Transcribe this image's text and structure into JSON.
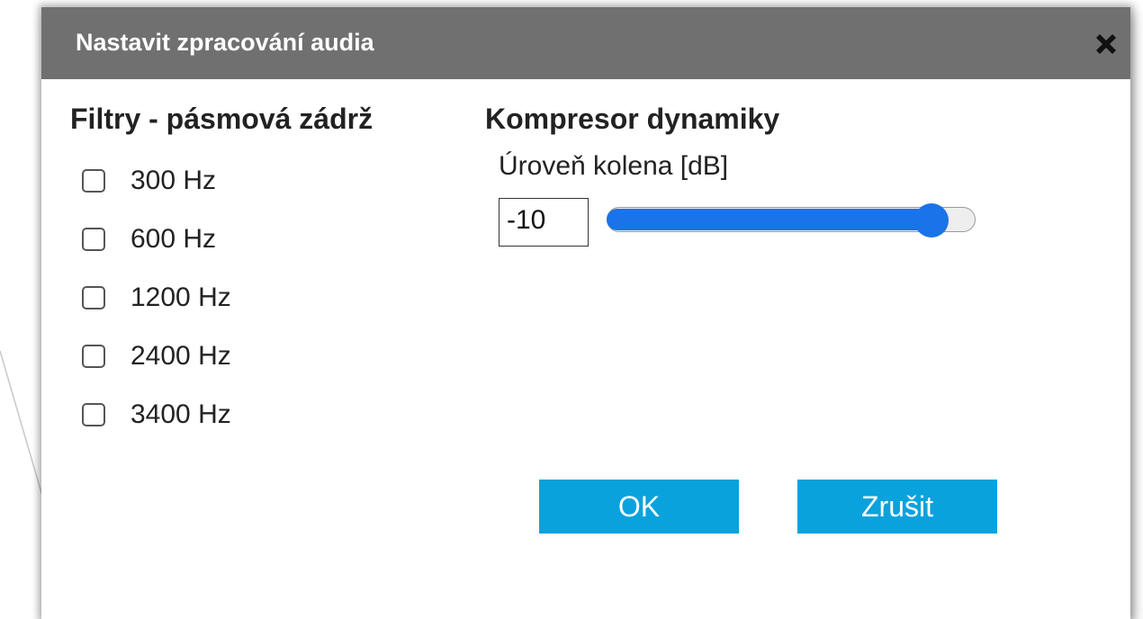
{
  "dialog": {
    "title": "Nastavit zpracování audia",
    "close_icon": "close-x-icon"
  },
  "filters": {
    "heading": "Filtry - pásmová zádrž",
    "items": [
      {
        "label": "300 Hz",
        "checked": false
      },
      {
        "label": "600 Hz",
        "checked": false
      },
      {
        "label": "1200 Hz",
        "checked": false
      },
      {
        "label": "2400 Hz",
        "checked": false
      },
      {
        "label": "3400 Hz",
        "checked": false
      }
    ]
  },
  "compressor": {
    "heading": "Kompresor dynamiky",
    "knee_label": "Úroveň kolena [dB]",
    "knee_value": "-10",
    "slider_fraction": 0.88
  },
  "buttons": {
    "ok": "OK",
    "cancel": "Zrušit"
  },
  "colors": {
    "titlebar": "#707070",
    "accent_button": "#0aa2dd",
    "slider": "#1a73e8"
  }
}
